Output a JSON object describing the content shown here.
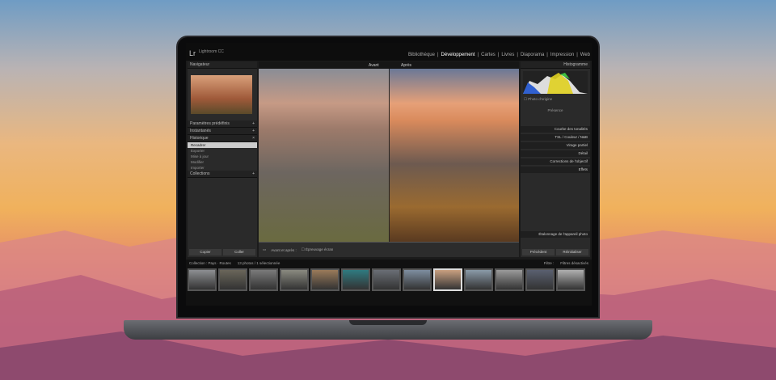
{
  "app": {
    "logo": "Lr",
    "product": "Lightroom CC"
  },
  "modules": [
    "Bibliothèque",
    "Développement",
    "Cartes",
    "Livres",
    "Diaporama",
    "Impression",
    "Web"
  ],
  "active_module": "Développement",
  "left_panel": {
    "navigator": "Navigateur",
    "presets": "Paramètres prédéfinis",
    "snapshots": "Instantanés",
    "history": "Historique",
    "history_items": [
      "Recadrer",
      "Exporter",
      "Mise à jour",
      "Modifier",
      "Importer"
    ],
    "collections": "Collections",
    "copy": "Copier",
    "paste": "Coller"
  },
  "view": {
    "before": "Avant",
    "after": "Après"
  },
  "right_panel": {
    "histogram": "Histogramme",
    "original_photo": "Photo d'origine",
    "presence": "Présence",
    "sections": [
      "Courbe des tonalités",
      "TSL / Couleur / N&B",
      "Virage partiel",
      "Détail",
      "Corrections de l'objectif",
      "Effets",
      "Étalonnage de l'appareil photo"
    ],
    "previous": "Précédent",
    "reset": "Réinitialiser"
  },
  "toolbar": {
    "before_after": "Avant et après :",
    "soft_proof": "Épreuvage écran"
  },
  "filmstrip": {
    "source": "Collection : Pays · Routes",
    "count": "13 photos / 1 sélectionnée",
    "filter": "Filtre :",
    "filter_value": "Filtres désactivés"
  },
  "thumb_colors": [
    "#8d8f92",
    "#6a665a",
    "#7a7a7a",
    "#8a8a80",
    "#9a7a5a",
    "#2f7a80",
    "#6a6e75",
    "#7e8ea0",
    "#c9a080",
    "#8a9aa8",
    "#9a9a9a",
    "#5a6070",
    "#b0b0b0"
  ]
}
